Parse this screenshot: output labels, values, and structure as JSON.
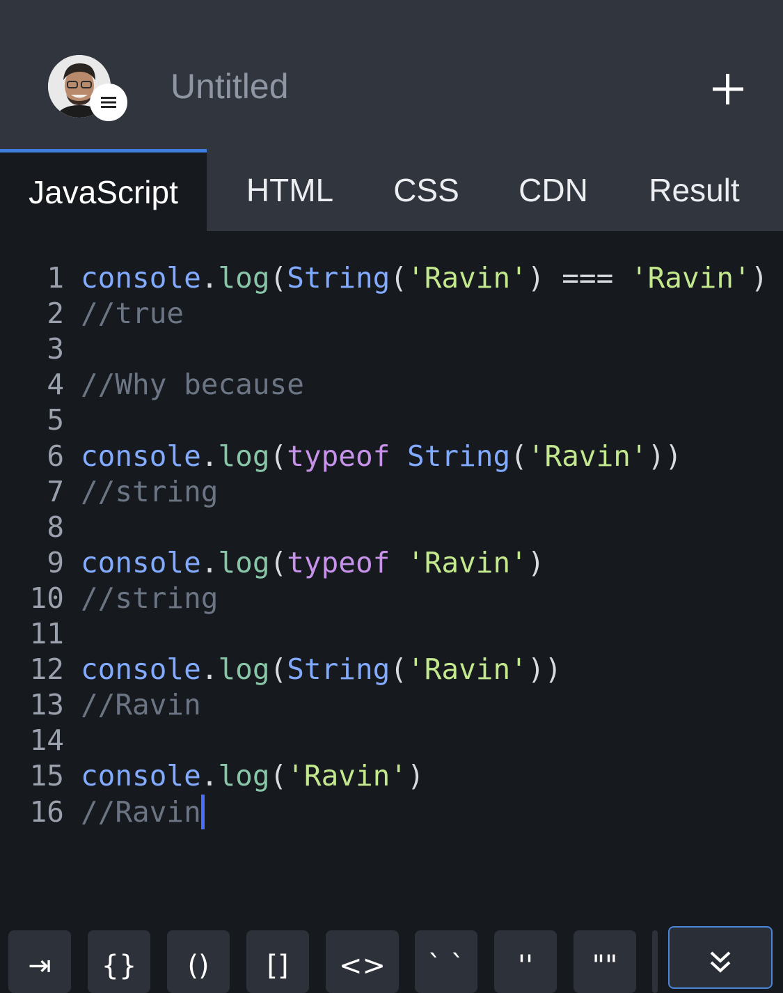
{
  "header": {
    "title": "Untitled",
    "avatar_icon": "user-avatar",
    "menu_icon": "menu-lines-icon",
    "add_icon": "plus-icon"
  },
  "tabs": [
    {
      "label": "JavaScript",
      "active": true
    },
    {
      "label": "HTML",
      "active": false
    },
    {
      "label": "CSS",
      "active": false
    },
    {
      "label": "CDN",
      "active": false
    },
    {
      "label": "Result",
      "active": false
    }
  ],
  "editor": {
    "lines": [
      {
        "n": "1",
        "tokens": [
          [
            "console",
            "console"
          ],
          [
            "p",
            "."
          ],
          [
            "fn",
            "log"
          ],
          [
            "p",
            "("
          ],
          [
            "class",
            "String"
          ],
          [
            "p",
            "("
          ],
          [
            "str",
            "'Ravin'"
          ],
          [
            "p",
            ") === "
          ],
          [
            "str",
            "'Ravin'"
          ],
          [
            "p",
            ")"
          ]
        ]
      },
      {
        "n": "2",
        "tokens": [
          [
            "cm",
            "//true"
          ]
        ]
      },
      {
        "n": "3",
        "tokens": []
      },
      {
        "n": "4",
        "tokens": [
          [
            "cm",
            "//Why because"
          ]
        ]
      },
      {
        "n": "5",
        "tokens": []
      },
      {
        "n": "6",
        "tokens": [
          [
            "console",
            "console"
          ],
          [
            "p",
            "."
          ],
          [
            "fn",
            "log"
          ],
          [
            "p",
            "("
          ],
          [
            "kw",
            "typeof "
          ],
          [
            "class",
            "String"
          ],
          [
            "p",
            "("
          ],
          [
            "str",
            "'Ravin'"
          ],
          [
            "p",
            "))"
          ]
        ]
      },
      {
        "n": "7",
        "tokens": [
          [
            "cm",
            "//string"
          ]
        ]
      },
      {
        "n": "8",
        "tokens": []
      },
      {
        "n": "9",
        "tokens": [
          [
            "console",
            "console"
          ],
          [
            "p",
            "."
          ],
          [
            "fn",
            "log"
          ],
          [
            "p",
            "("
          ],
          [
            "kw",
            "typeof "
          ],
          [
            "str",
            "'Ravin'"
          ],
          [
            "p",
            ")"
          ]
        ]
      },
      {
        "n": "10",
        "tokens": [
          [
            "cm",
            "//string"
          ]
        ]
      },
      {
        "n": "11",
        "tokens": []
      },
      {
        "n": "12",
        "tokens": [
          [
            "console",
            "console"
          ],
          [
            "p",
            "."
          ],
          [
            "fn",
            "log"
          ],
          [
            "p",
            "("
          ],
          [
            "class",
            "String"
          ],
          [
            "p",
            "("
          ],
          [
            "str",
            "'Ravin'"
          ],
          [
            "p",
            "))"
          ]
        ]
      },
      {
        "n": "13",
        "tokens": [
          [
            "cm",
            "//Ravin"
          ]
        ]
      },
      {
        "n": "14",
        "tokens": []
      },
      {
        "n": "15",
        "tokens": [
          [
            "console",
            "console"
          ],
          [
            "p",
            "."
          ],
          [
            "fn",
            "log"
          ],
          [
            "p",
            "("
          ],
          [
            "str",
            "'Ravin'"
          ],
          [
            "p",
            ")"
          ]
        ]
      },
      {
        "n": "16",
        "tokens": [
          [
            "cm",
            "//Ravin"
          ]
        ],
        "cursor": true
      }
    ]
  },
  "keybar": {
    "keys": [
      {
        "label": "⇥",
        "name": "tab-key"
      },
      {
        "label": "{}",
        "name": "braces-key"
      },
      {
        "label": "()",
        "name": "parens-key"
      },
      {
        "label": "[]",
        "name": "brackets-key"
      },
      {
        "label": "<>",
        "name": "angle-brackets-key"
      },
      {
        "label": "` `",
        "name": "backticks-key"
      },
      {
        "label": "''",
        "name": "single-quotes-key"
      },
      {
        "label": "\"\"",
        "name": "double-quotes-key"
      }
    ],
    "collapse_icon": "chevron-double-down-icon"
  },
  "colors": {
    "accent": "#3e7fe0",
    "header_bg": "#31353d",
    "editor_bg": "#16191e",
    "cursor": "#4a6cff"
  }
}
